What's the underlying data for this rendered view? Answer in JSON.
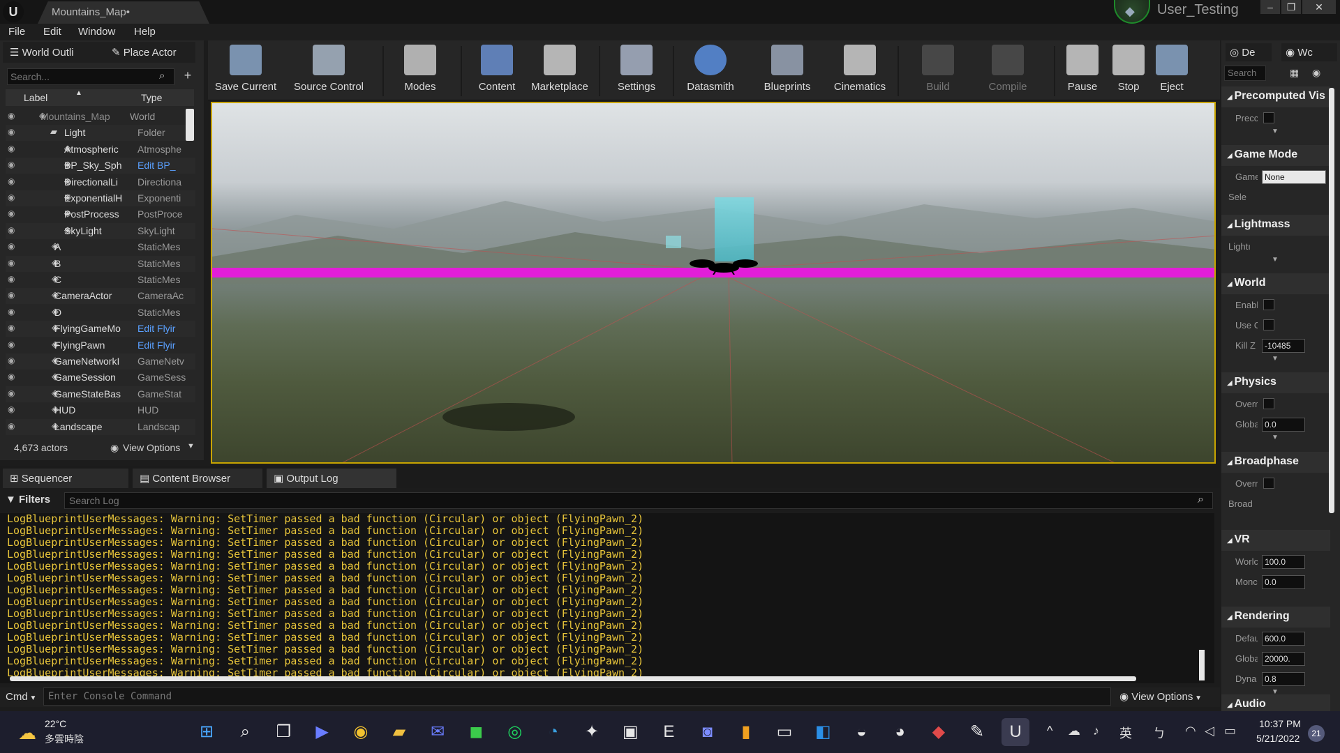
{
  "window": {
    "tab_title": "Mountains_Map•",
    "user": "User_Testing",
    "min": "–",
    "max": "❐",
    "close": "✕"
  },
  "menu": [
    "File",
    "Edit",
    "Window",
    "Help"
  ],
  "outliner": {
    "tab_label": "World Outli",
    "place_actor_label": "Place Actor",
    "search_placeholder": "Search...",
    "col_label": "Label",
    "col_type": "Type",
    "rows": [
      {
        "label": "Mountains_Map",
        "type": "World",
        "link": false
      },
      {
        "label": "Light",
        "type": "Folder",
        "link": false
      },
      {
        "label": "Atmospheric",
        "type": "Atmosphe",
        "link": false
      },
      {
        "label": "BP_Sky_Sph",
        "type": "Edit BP_",
        "link": true
      },
      {
        "label": "DirectionalLi",
        "type": "Directiona",
        "link": false
      },
      {
        "label": "ExponentialH",
        "type": "Exponenti",
        "link": false
      },
      {
        "label": "PostProcess",
        "type": "PostProce",
        "link": false
      },
      {
        "label": "SkyLight",
        "type": "SkyLight",
        "link": false
      },
      {
        "label": "A",
        "type": "StaticMes",
        "link": false
      },
      {
        "label": "B",
        "type": "StaticMes",
        "link": false
      },
      {
        "label": "C",
        "type": "StaticMes",
        "link": false
      },
      {
        "label": "CameraActor",
        "type": "CameraAc",
        "link": false
      },
      {
        "label": "D",
        "type": "StaticMes",
        "link": false
      },
      {
        "label": "FlyingGameMo",
        "type": "Edit Flyir",
        "link": true
      },
      {
        "label": "FlyingPawn",
        "type": "Edit Flyir",
        "link": true
      },
      {
        "label": "GameNetworkI",
        "type": "GameNetv",
        "link": false
      },
      {
        "label": "GameSession",
        "type": "GameSess",
        "link": false
      },
      {
        "label": "GameStateBas",
        "type": "GameStat",
        "link": false
      },
      {
        "label": "HUD",
        "type": "HUD",
        "link": false
      },
      {
        "label": "Landscape",
        "type": "Landscap",
        "link": false
      }
    ],
    "actor_count": "4,673 actors",
    "view_options": "View Options"
  },
  "toolbar": [
    {
      "label": "Save Current",
      "icon": "save-icon",
      "disabled": false
    },
    {
      "label": "Source Control",
      "icon": "source-control-icon",
      "disabled": false
    },
    {
      "label": "Modes",
      "icon": "modes-icon",
      "disabled": false
    },
    {
      "label": "Content",
      "icon": "content-icon",
      "disabled": false
    },
    {
      "label": "Marketplace",
      "icon": "marketplace-icon",
      "disabled": false
    },
    {
      "label": "Settings",
      "icon": "settings-icon",
      "disabled": false
    },
    {
      "label": "Datasmith",
      "icon": "datasmith-icon",
      "disabled": false
    },
    {
      "label": "Blueprints",
      "icon": "blueprints-icon",
      "disabled": false
    },
    {
      "label": "Cinematics",
      "icon": "cinematics-icon",
      "disabled": false
    },
    {
      "label": "Build",
      "icon": "build-icon",
      "disabled": true
    },
    {
      "label": "Compile",
      "icon": "compile-icon",
      "disabled": true
    },
    {
      "label": "Pause",
      "icon": "pause-icon",
      "disabled": false
    },
    {
      "label": "Stop",
      "icon": "stop-icon",
      "disabled": false
    },
    {
      "label": "Eject",
      "icon": "eject-icon",
      "disabled": false
    }
  ],
  "details": {
    "tab1": "De",
    "tab2": "Wc",
    "search_placeholder": "Search",
    "sections": [
      {
        "title": "Precomputed Vis",
        "props": [
          {
            "name": "Precc",
            "kind": "check"
          }
        ]
      },
      {
        "title": "Game Mode",
        "props": [
          {
            "name": "Game",
            "kind": "select",
            "value": "None"
          },
          {
            "name": "Sele",
            "kind": "expand"
          }
        ]
      },
      {
        "title": "Lightmass",
        "props": [
          {
            "name": "Lightı",
            "kind": "expand"
          }
        ]
      },
      {
        "title": "World",
        "props": [
          {
            "name": "Enabl",
            "kind": "check"
          },
          {
            "name": "Use C",
            "kind": "check"
          },
          {
            "name": "Kill Z",
            "kind": "value",
            "value": "-10485"
          }
        ]
      },
      {
        "title": "Physics",
        "props": [
          {
            "name": "Overr",
            "kind": "check"
          },
          {
            "name": "Globa",
            "kind": "value",
            "value": "0.0"
          }
        ]
      },
      {
        "title": "Broadphase",
        "props": [
          {
            "name": "Overr",
            "kind": "check"
          },
          {
            "name": "Broad",
            "kind": "expand"
          }
        ]
      },
      {
        "title": "VR",
        "props": [
          {
            "name": "Worlc",
            "kind": "value",
            "value": "100.0"
          },
          {
            "name": "Monc",
            "kind": "value",
            "value": "0.0"
          }
        ]
      },
      {
        "title": "Rendering",
        "props": [
          {
            "name": "Defau",
            "kind": "value",
            "value": "600.0"
          },
          {
            "name": "Globa",
            "kind": "value",
            "value": "20000."
          },
          {
            "name": "Dyna",
            "kind": "value",
            "value": "0.8"
          }
        ]
      },
      {
        "title": "Audio",
        "props": []
      }
    ]
  },
  "bottom_tabs": [
    "Sequencer",
    "Content Browser",
    "Output Log"
  ],
  "log": {
    "filters": "Filters",
    "search_placeholder": "Search Log",
    "lines": [
      "LogBlueprintUserMessages: Warning: SetTimer passed a bad function (Circular) or object (FlyingPawn_2)",
      "LogBlueprintUserMessages: Warning: SetTimer passed a bad function (Circular) or object (FlyingPawn_2)",
      "LogBlueprintUserMessages: Warning: SetTimer passed a bad function (Circular) or object (FlyingPawn_2)",
      "LogBlueprintUserMessages: Warning: SetTimer passed a bad function (Circular) or object (FlyingPawn_2)",
      "LogBlueprintUserMessages: Warning: SetTimer passed a bad function (Circular) or object (FlyingPawn_2)",
      "LogBlueprintUserMessages: Warning: SetTimer passed a bad function (Circular) or object (FlyingPawn_2)",
      "LogBlueprintUserMessages: Warning: SetTimer passed a bad function (Circular) or object (FlyingPawn_2)",
      "LogBlueprintUserMessages: Warning: SetTimer passed a bad function (Circular) or object (FlyingPawn_2)",
      "LogBlueprintUserMessages: Warning: SetTimer passed a bad function (Circular) or object (FlyingPawn_2)",
      "LogBlueprintUserMessages: Warning: SetTimer passed a bad function (Circular) or object (FlyingPawn_2)",
      "LogBlueprintUserMessages: Warning: SetTimer passed a bad function (Circular) or object (FlyingPawn_2)",
      "LogBlueprintUserMessages: Warning: SetTimer passed a bad function (Circular) or object (FlyingPawn_2)",
      "LogBlueprintUserMessages: Warning: SetTimer passed a bad function (Circular) or object (FlyingPawn_2)",
      "LogBlueprintUserMessages: Warning: SetTimer passed a bad function (Circular) or object (FlyingPawn_2)"
    ],
    "cmd": "Cmd",
    "cmd_placeholder": "Enter Console Command",
    "view_options": "View Options"
  },
  "taskbar": {
    "temp": "22°C",
    "weather": "多雲時陰",
    "time": "10:37 PM",
    "date": "5/21/2022",
    "notifications": "21",
    "ime": "英",
    "apps": [
      "windows-start-icon",
      "search-icon",
      "task-view-icon",
      "zoom-icon",
      "chrome-icon",
      "file-explorer-icon",
      "messenger-icon",
      "line-icon",
      "spotify-icon",
      "edge-icon",
      "unreal-launcher-icon",
      "roblox-icon",
      "epic-games-icon",
      "discord-icon",
      "app-icon",
      "terminal-icon",
      "vscode-icon",
      "steam-icon",
      "github-icon",
      "game-icon",
      "notes-icon",
      "unreal-editor-icon"
    ]
  },
  "colors": {
    "accent_pink": "#e21ed8",
    "viewport_border": "#c8a400",
    "log_text": "#e8c53a",
    "link_blue": "#5aa0ff"
  }
}
